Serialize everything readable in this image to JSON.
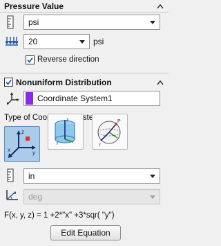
{
  "pressure_value": {
    "title": "Pressure Value",
    "unit_select": "psi",
    "value": "20",
    "unit_label": "psi",
    "reverse_label": "Reverse direction",
    "reverse_checked": true
  },
  "nonuniform": {
    "title": "Nonuniform Distribution",
    "checked": true,
    "coordinate_system_value": "Coordinate System1",
    "coordinate_color": "#8a2be2",
    "type_label": "Type of Coordinate System:",
    "types": [
      {
        "name": "cartesian",
        "icon": "cartesian-coords-icon",
        "selected": true
      },
      {
        "name": "cylindrical",
        "icon": "cylindrical-coords-icon",
        "selected": false
      },
      {
        "name": "spherical",
        "icon": "spherical-coords-icon",
        "selected": false
      }
    ],
    "length_unit": "in",
    "angle_unit": "deg",
    "equation": "F(x, y, z) = 1 +2*\"x\" +3*sqr( \"y\")",
    "edit_button": "Edit Equation"
  },
  "colors": {
    "accent_blue": "#1e5aa8",
    "selected_bg": "#aacce8",
    "check_mark": "#1e5aa8"
  }
}
